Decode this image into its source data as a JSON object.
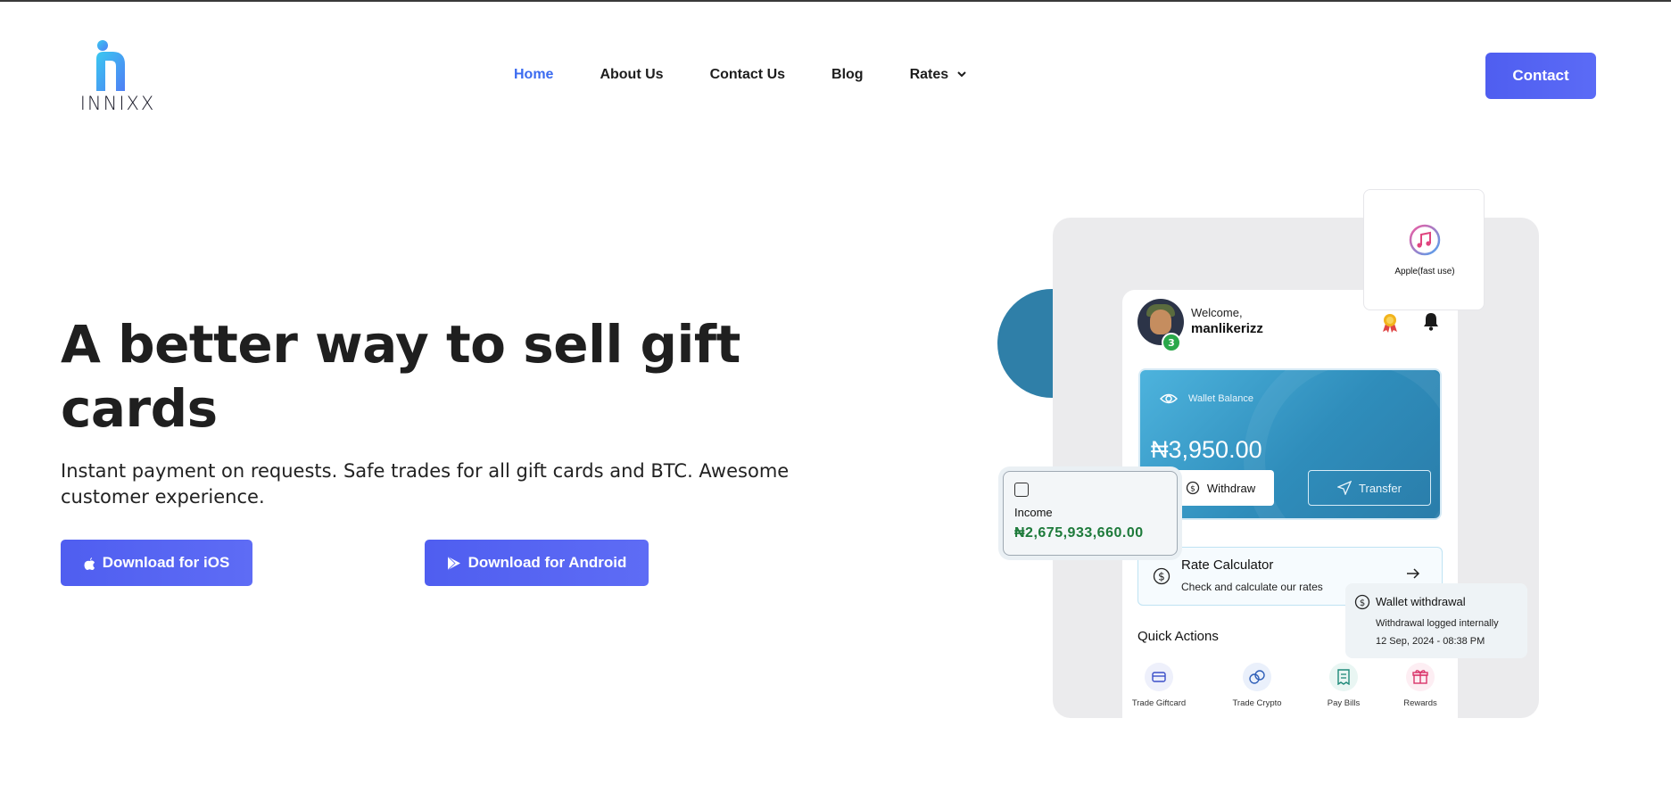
{
  "brand": {
    "name": "INNIXX"
  },
  "nav": {
    "items": [
      {
        "label": "Home"
      },
      {
        "label": "About Us"
      },
      {
        "label": "Contact Us"
      },
      {
        "label": "Blog"
      },
      {
        "label": "Rates"
      }
    ],
    "contact_label": "Contact"
  },
  "hero": {
    "title": "A better way to sell gift cards",
    "subtitle": "Instant payment on requests. Safe trades for all gift cards and BTC. Awesome customer experience.",
    "ios_label": "Download for iOS",
    "android_label": "Download for Android"
  },
  "app": {
    "welcome": "Welcome,",
    "username": "manlikerizz",
    "avatar_badge": "3",
    "wallet_label": "Wallet Balance",
    "wallet_balance": "₦3,950.00",
    "withdraw_label": "Withdraw",
    "transfer_label": "Transfer",
    "rate_title": "Rate Calculator",
    "rate_subtitle": "Check and calculate our rates",
    "quick_actions_title": "Quick Actions",
    "quick_actions": [
      {
        "label": "Trade Giftcard",
        "icon": "card-icon"
      },
      {
        "label": "Trade Crypto",
        "icon": "crypto-icon"
      },
      {
        "label": "Pay Bills",
        "icon": "receipt-icon"
      },
      {
        "label": "Rewards",
        "icon": "gift-icon"
      }
    ]
  },
  "apple_card": {
    "label": "Apple(fast use)",
    "icon": "music-note-icon"
  },
  "income_card": {
    "label": "Income",
    "amount": "₦2,675,933,660.00"
  },
  "withdrawal_card": {
    "title": "Wallet withdrawal",
    "subtitle": "Withdrawal logged internally",
    "date": "12 Sep, 2024 - 08:38 PM"
  },
  "colors": {
    "accent": "#4f5ef0",
    "nav_active": "#3b6bf0",
    "wallet_blue": "#2f8dbb",
    "income_green": "#1d7a3a"
  }
}
